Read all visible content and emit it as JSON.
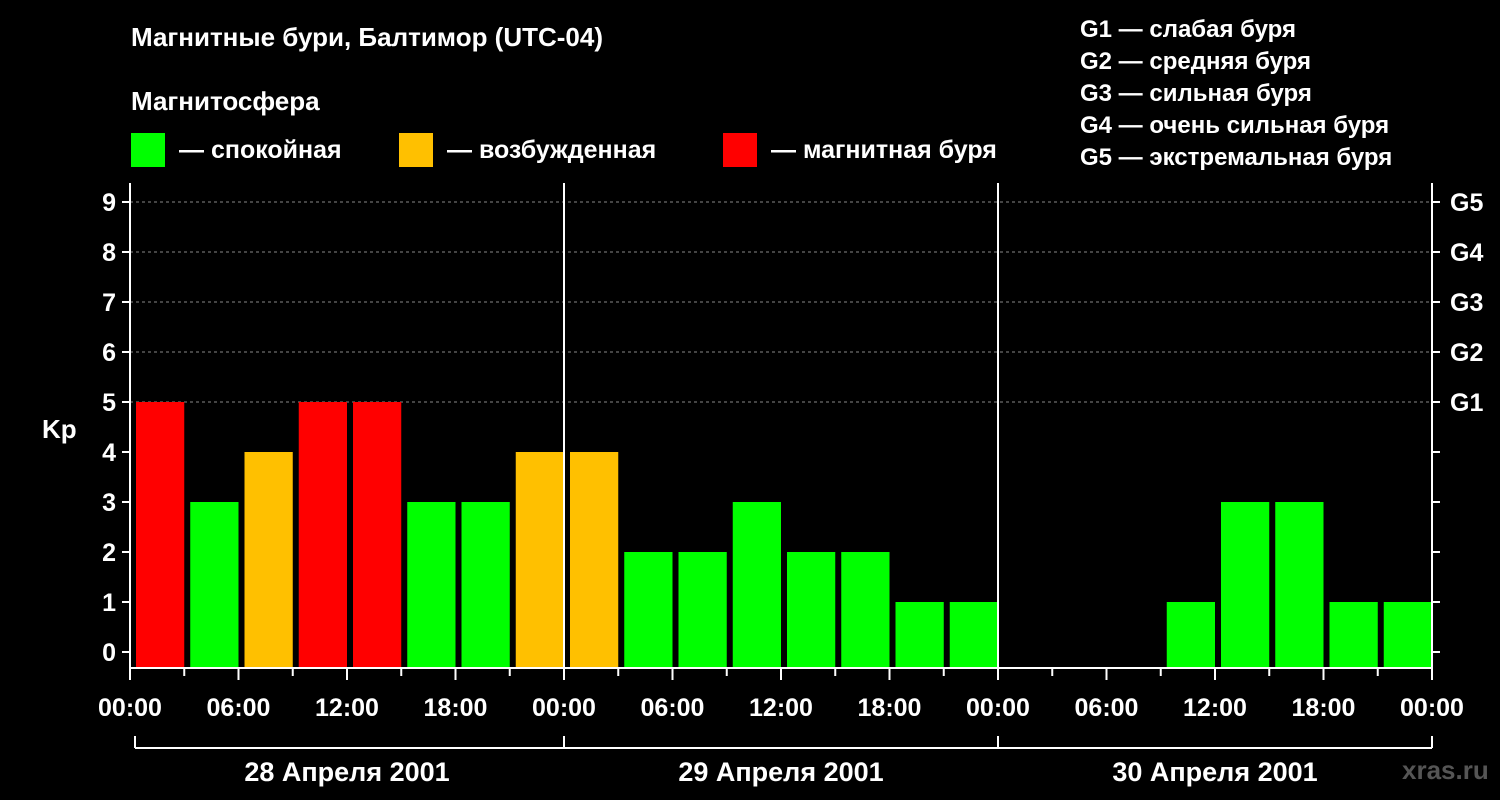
{
  "title": "Магнитные бури, Балтимор (UTC-04)",
  "subtitle": "Магнитосфера",
  "legend": [
    {
      "label": "— спокойная",
      "color": "#00ff00"
    },
    {
      "label": "— возбужденная",
      "color": "#ffc000"
    },
    {
      "label": "— магнитная буря",
      "color": "#ff0000"
    }
  ],
  "g_legend": [
    "G1 — слабая буря",
    "G2 — средняя буря",
    "G3 — сильная буря",
    "G4 — очень сильная буря",
    "G5 — экстремальная буря"
  ],
  "watermark": "xras.ru",
  "colors": {
    "calm": "#00ff00",
    "active": "#ffc000",
    "storm": "#ff0000",
    "grid": "#888888",
    "axis": "#ffffff"
  },
  "chart_data": {
    "type": "bar",
    "ylabel": "Kp",
    "ylim": [
      0,
      9
    ],
    "yticks": [
      "0",
      "1",
      "2",
      "3",
      "4",
      "5",
      "6",
      "7",
      "8",
      "9"
    ],
    "right_ticks": [
      {
        "value": 5,
        "label": "G1"
      },
      {
        "value": 6,
        "label": "G2"
      },
      {
        "value": 7,
        "label": "G3"
      },
      {
        "value": 8,
        "label": "G4"
      },
      {
        "value": 9,
        "label": "G5"
      }
    ],
    "grid_dashed_levels": [
      5,
      6,
      7,
      8,
      9
    ],
    "xlim_hours": [
      0,
      72
    ],
    "x_tick_labels": [
      "00:00",
      "06:00",
      "12:00",
      "18:00",
      "00:00",
      "06:00",
      "12:00",
      "18:00",
      "00:00",
      "06:00",
      "12:00",
      "18:00",
      "00:00"
    ],
    "days": [
      "28 Апреля 2001",
      "29 Апреля 2001",
      "30 Апреля 2001"
    ],
    "interval_hours": 3,
    "values": [
      5,
      3,
      4,
      5,
      5,
      3,
      3,
      4,
      4,
      2,
      2,
      3,
      2,
      2,
      1,
      1,
      null,
      null,
      null,
      1,
      3,
      3,
      1,
      1
    ],
    "levels": [
      "storm",
      "calm",
      "active",
      "storm",
      "storm",
      "calm",
      "calm",
      "active",
      "active",
      "calm",
      "calm",
      "calm",
      "calm",
      "calm",
      "calm",
      "calm",
      null,
      null,
      null,
      "calm",
      "calm",
      "calm",
      "calm",
      "calm"
    ]
  }
}
